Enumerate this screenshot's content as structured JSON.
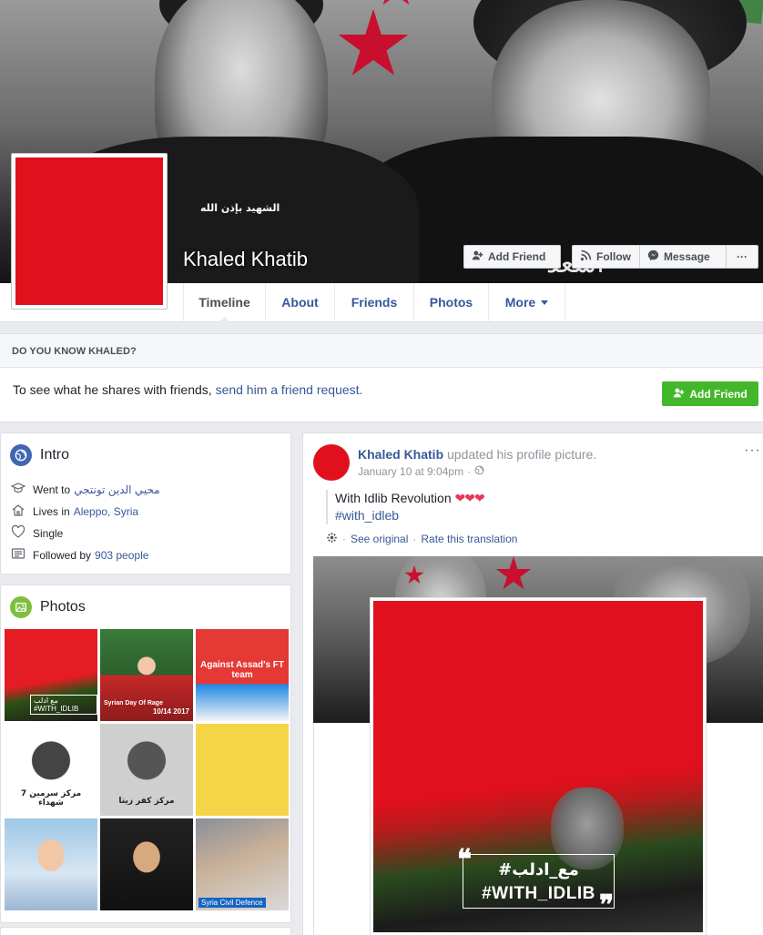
{
  "profile": {
    "name": "Khaled Khatib",
    "cover_arabic_text": "الشهيد بإذن الله",
    "cover_calligraphy": "أسعد"
  },
  "header_buttons": {
    "add_friend": "Add Friend",
    "follow": "Follow",
    "message": "Message",
    "more": "···"
  },
  "tabs": [
    {
      "label": "Timeline"
    },
    {
      "label": "About"
    },
    {
      "label": "Friends"
    },
    {
      "label": "Photos"
    },
    {
      "label": "More"
    }
  ],
  "know_box": {
    "heading": "Do you know Khaled?",
    "text_prefix": "To see what he shares with friends, ",
    "link": "send him a friend request.",
    "button": "Add Friend"
  },
  "intro": {
    "title": "Intro",
    "items": [
      {
        "prefix": "Went to",
        "value": "محيي الدين تونتجي"
      },
      {
        "prefix": "Lives in",
        "value": "Aleppo, Syria"
      },
      {
        "prefix": "Single",
        "value": ""
      },
      {
        "prefix": "Followed by",
        "value": "903 people"
      }
    ]
  },
  "photos": {
    "title": "Photos",
    "thumb_texts": {
      "t1_tag": "مع ادلب #WITH_IDLIB",
      "t2_caption": "Syrian Day Of Rage",
      "t2_date": "10/14 2017",
      "t3_title": "Against Assad's FT team",
      "t4_caption": "مركز سرمين 7 شهداء",
      "t5_caption": "مركز كفر زيتا",
      "t9_caption": "Syria Civil Defence"
    }
  },
  "post": {
    "author": "Khaled Khatib",
    "action": " updated his profile picture.",
    "time": "January 10 at 9:04pm",
    "dots": "···",
    "text": "With Idlib Revolution",
    "hearts": "❤❤❤",
    "hashtag": "#with_idleb",
    "see_original": "See original",
    "rate_translation": "Rate this translation",
    "image_arabic": "#مع_ادلب",
    "image_english": "#WITH_IDLIB"
  },
  "colors": {
    "link_blue": "#365899",
    "add_friend_green": "#42b72a",
    "profile_red": "#e0101d",
    "page_bg": "#e9ebee"
  }
}
